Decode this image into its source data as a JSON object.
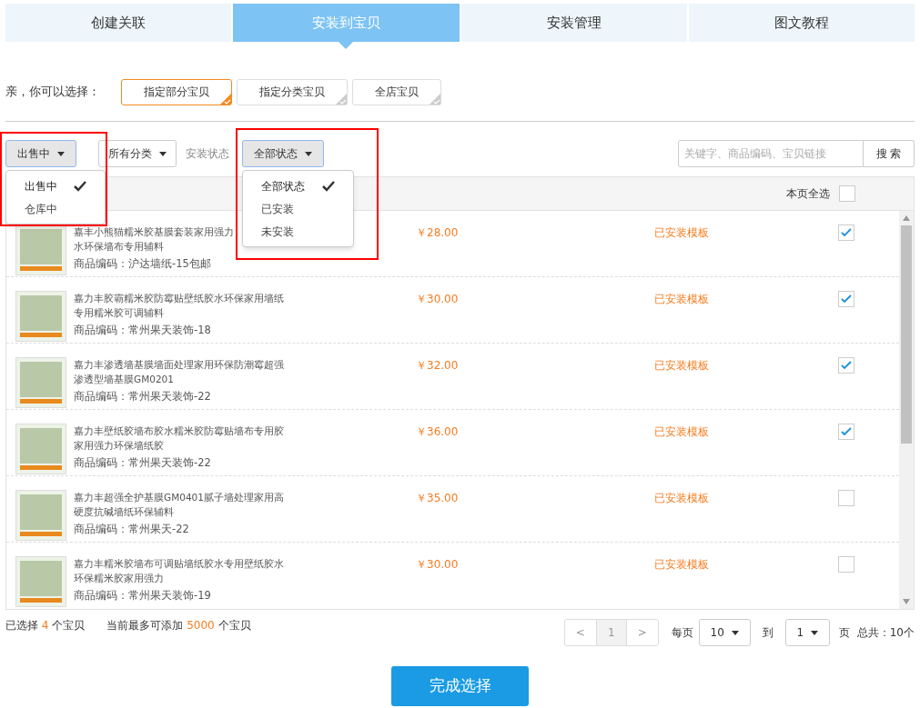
{
  "tabs": [
    {
      "label": "创建关联",
      "selected": false
    },
    {
      "label": "安装到宝贝",
      "selected": true
    },
    {
      "label": "安装管理",
      "selected": false
    },
    {
      "label": "图文教程",
      "selected": false
    }
  ],
  "choice": {
    "label": "亲，你可以选择：",
    "options": [
      {
        "label": "指定部分宝贝",
        "selected": true
      },
      {
        "label": "指定分类宝贝",
        "selected": false
      },
      {
        "label": "全店宝贝",
        "selected": false
      }
    ]
  },
  "filters": {
    "sale_status": {
      "value": "出售中",
      "open": true,
      "options": [
        {
          "label": "出售中",
          "selected": true
        },
        {
          "label": "仓库中",
          "selected": false
        }
      ]
    },
    "category": {
      "value": "所有分类",
      "open": false
    },
    "install_state": {
      "label": "安装状态",
      "value": "全部状态",
      "open": true,
      "options": [
        {
          "label": "全部状态",
          "selected": true
        },
        {
          "label": "已安装",
          "selected": false
        },
        {
          "label": "未安装",
          "selected": false
        }
      ]
    }
  },
  "search": {
    "placeholder": "关键字、商品编码、宝贝链接",
    "button": "搜 索"
  },
  "select_all": {
    "label": "本页全选",
    "checked": false
  },
  "rows": [
    {
      "title_lines": [
        "嘉丰小熊猫糯米胶基膜套装家用强力",
        "水环保墙布专用辅料"
      ],
      "code": "商品编码：沪达墙纸-15包邮",
      "price": "￥28.00",
      "status": "已安装模板",
      "checked": true
    },
    {
      "title_lines": [
        "嘉力丰胶霸糯米胶防霉贴壁纸胶水环保家用墙纸",
        "专用糯米胶可调辅料"
      ],
      "code": "商品编码：常州果天装饰-18",
      "price": "￥30.00",
      "status": "已安装模板",
      "checked": true
    },
    {
      "title_lines": [
        "嘉力丰渗透墙基膜墙面处理家用环保防潮霉超强",
        "渗透型墙基膜GM0201"
      ],
      "code": "商品编码：常州果天装饰-22",
      "price": "￥32.00",
      "status": "已安装模板",
      "checked": true
    },
    {
      "title_lines": [
        "嘉力丰壁纸胶墙布胶水糯米胶防霉贴墙布专用胶",
        "家用强力环保墙纸胶"
      ],
      "code": "商品编码：常州果天装饰-22",
      "price": "￥36.00",
      "status": "已安装模板",
      "checked": true
    },
    {
      "title_lines": [
        "嘉力丰超强全护基膜GM0401腻子墙处理家用高",
        "硬度抗碱墙纸环保辅料"
      ],
      "code": "商品编码：常州果天-22",
      "price": "￥35.00",
      "status": "已安装模板",
      "checked": false
    },
    {
      "title_lines": [
        "嘉力丰糯米胶墙布可调贴墙纸胶水专用壁纸胶水",
        "环保糯米胶家用强力"
      ],
      "code": "商品编码：常州果天装饰-19",
      "price": "￥30.00",
      "status": "已安装模板",
      "checked": false
    }
  ],
  "footer": {
    "selected": {
      "prefix": "已选择",
      "count": "4",
      "suffix": "个宝贝"
    },
    "limit": {
      "prefix": "当前最多可添加",
      "count": "5000",
      "suffix": "个宝贝"
    }
  },
  "pagination": {
    "prev": "<",
    "page": "1",
    "next": ">",
    "per_page_label": "每页",
    "per_page": "10",
    "goto_label": "到",
    "goto": "1",
    "page_label": "页",
    "total": "总共：10个"
  },
  "finish_button": "完成选择"
}
